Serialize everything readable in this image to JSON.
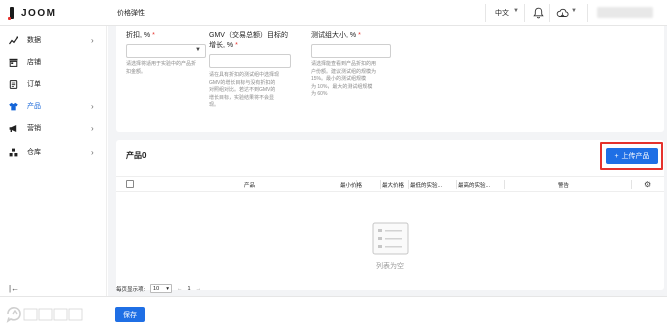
{
  "header": {
    "logo_text": "JOOM",
    "page_title": "价格弹性",
    "language": "中文"
  },
  "sidebar": {
    "items": [
      {
        "label": "数据",
        "icon": "analytics-icon",
        "has_chevron": true,
        "active": false
      },
      {
        "label": "店铺",
        "icon": "store-icon",
        "has_chevron": false,
        "active": false
      },
      {
        "label": "订单",
        "icon": "orders-icon",
        "has_chevron": false,
        "active": false
      },
      {
        "label": "产品",
        "icon": "shirt-icon",
        "has_chevron": true,
        "active": true
      },
      {
        "label": "营销",
        "icon": "megaphone-icon",
        "has_chevron": true,
        "active": false
      },
      {
        "label": "仓库",
        "icon": "warehouse-icon",
        "has_chevron": true,
        "active": false
      }
    ]
  },
  "form": {
    "discount": {
      "label": "折扣, %",
      "help": [
        "请选择将适用于实验中的产品折",
        "扣金额。"
      ]
    },
    "gmv": {
      "label_line1": "GMV（交易总额）目标的",
      "label_line2": "增长, %",
      "help": [
        "请在具有折扣的测试组中选择现",
        "GMV的增长目标与没有折扣的",
        "对照组对比。若达不到GMV的",
        "增长目标，实验结果将不会显",
        "现。"
      ]
    },
    "test_size": {
      "label": "测试组大小, %",
      "help": [
        "请选择能查看到产品折扣的用",
        "户份额。建议测试组的规模为",
        "15%。最小的测试组规模",
        "为 10%，最大的测试组规模",
        "为 60%"
      ]
    }
  },
  "products": {
    "title": "产品0",
    "upload_label": "上传产品",
    "columns": [
      "产品",
      "最小价格",
      "最大价格",
      "最低的实验...",
      "最高的实验...",
      "警告"
    ],
    "empty_text": "列表为空"
  },
  "pager": {
    "label": "每页显示项:",
    "page_size": "10",
    "page_indicator": "1"
  },
  "footer": {
    "save_label": "保存",
    "watermark": "大数跨境"
  },
  "colors": {
    "accent": "#1f6fe5",
    "active_nav": "#1565d8",
    "highlight": "#e5322d"
  }
}
